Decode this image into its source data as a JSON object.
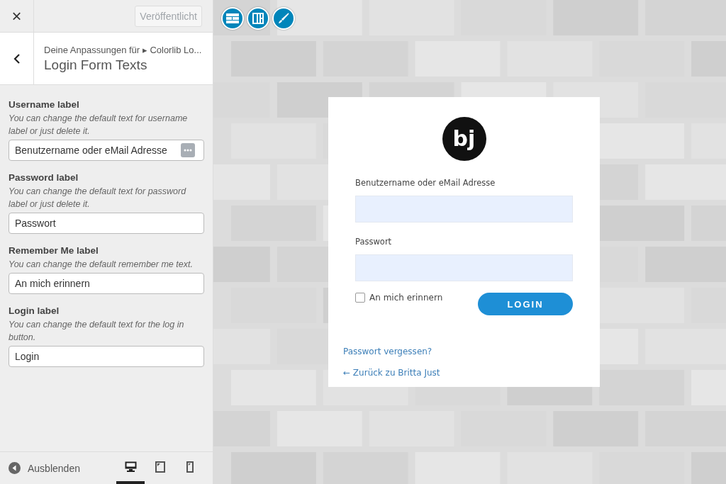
{
  "header": {
    "close": "×",
    "publish_button": {
      "label": "Veröffentlicht",
      "disabled": true
    }
  },
  "section": {
    "breadcrumb": "Deine Anpassungen für ▸ Colorlib Lo...",
    "title": "Login Form Texts"
  },
  "controls": [
    {
      "label": "Username label",
      "description": "You can change the default text for username label or just delete it.",
      "value": "Benutzername oder eMail Adresse",
      "has_menu": true
    },
    {
      "label": "Password label",
      "description": "You can change the default text for password label or just delete it.",
      "value": "Passwort",
      "has_menu": false
    },
    {
      "label": "Remember Me label",
      "description": "You can change the default remember me text.",
      "value": "An mich erinnern",
      "has_menu": false
    },
    {
      "label": "Login label",
      "description": "You can change the default text for the log in button.",
      "value": "Login",
      "has_menu": false
    }
  ],
  "footer": {
    "hide_label": "Ausblenden",
    "devices": [
      {
        "kind": "desktop",
        "selected": true
      },
      {
        "kind": "tablet",
        "selected": false
      },
      {
        "kind": "mobile",
        "selected": false
      }
    ]
  },
  "preview": {
    "toolbar": [
      {
        "kind": "layout"
      },
      {
        "kind": "columns"
      },
      {
        "kind": "brush"
      }
    ],
    "login_form": {
      "logo": "bj",
      "username_label": "Benutzername oder eMail Adresse",
      "password_label": "Passwort",
      "remember_label": "An mich erinnern",
      "remember_checked": false,
      "login_button": "LOGIN",
      "lost_password_link": "Passwort vergessen?",
      "back_link": "← Zurück zu Britta Just"
    }
  }
}
